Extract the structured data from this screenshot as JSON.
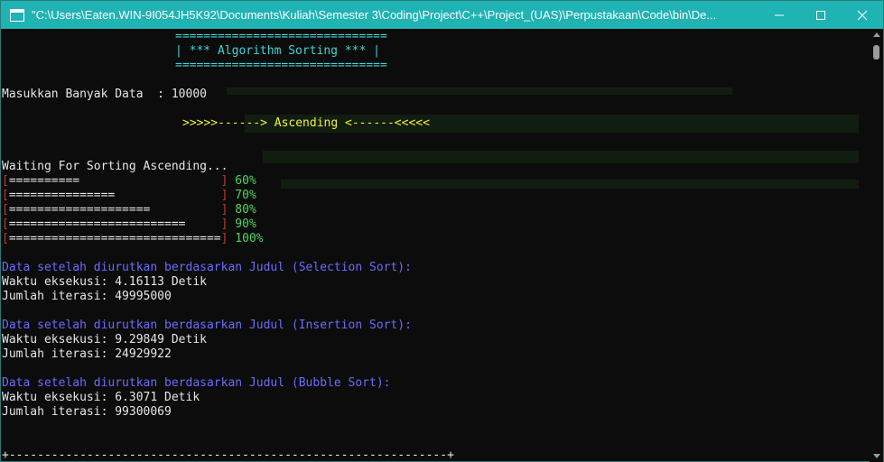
{
  "window": {
    "title": "\"C:\\Users\\Eaten.WIN-9I054JH5K92\\Documents\\Kuliah\\Semester 3\\Coding\\Project\\C++\\Project_(UAS)\\Perpustakaan\\Code\\bin\\De...",
    "buttons": [
      "minimize",
      "maximize",
      "close"
    ]
  },
  "console": {
    "header_rule_top": "==============================",
    "header_title": "| *** Algorithm Sorting *** |",
    "header_rule_bottom": "==============================",
    "input_label": "Masukkan Banyak Data  : ",
    "input_value": "10000",
    "order_banner": ">>>>>------> Ascending <------<<<<<",
    "waiting_text": "Waiting For Sorting Ascending...",
    "progress": [
      {
        "open": "[",
        "bar": "==========                    ",
        "close": "]",
        "percent": "60%"
      },
      {
        "open": "[",
        "bar": "===============               ",
        "close": "]",
        "percent": "70%"
      },
      {
        "open": "[",
        "bar": "====================          ",
        "close": "]",
        "percent": "80%"
      },
      {
        "open": "[",
        "bar": "=========================     ",
        "close": "]",
        "percent": "90%"
      },
      {
        "open": "[",
        "bar": "==============================",
        "close": "]",
        "percent": "100%"
      }
    ],
    "results": [
      {
        "heading": "Data setelah diurutkan berdasarkan Judul (Selection Sort):",
        "time": "Waktu eksekusi: 4.16113 Detik",
        "iterations": "Jumlah iterasi: 49995000"
      },
      {
        "heading": "Data setelah diurutkan berdasarkan Judul (Insertion Sort):",
        "time": "Waktu eksekusi: 9.29849 Detik",
        "iterations": "Jumlah iterasi: 24929922"
      },
      {
        "heading": "Data setelah diurutkan berdasarkan Judul (Bubble Sort):",
        "time": "Waktu eksekusi: 6.3071 Detik",
        "iterations": "Jumlah iterasi: 99300069"
      }
    ],
    "footer_rule": "+--------------------------------------------------------------+"
  },
  "colors": {
    "titlebar": "#1fb3b3",
    "background": "#0c0c0c",
    "cyan": "#3fd5d5",
    "yellow": "#f2f233",
    "red": "#c2392b",
    "green": "#4fd65a",
    "blue": "#6b6bff"
  }
}
